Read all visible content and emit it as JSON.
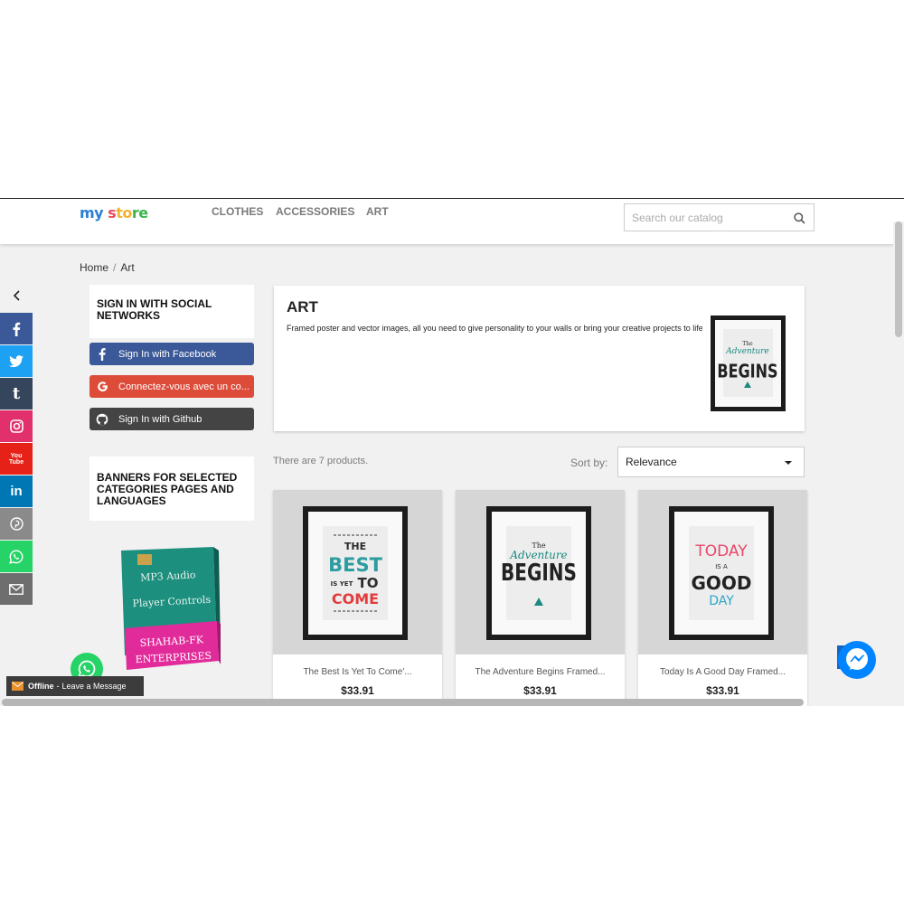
{
  "header": {
    "logo": {
      "part1": "my",
      "part2": " s",
      "part3": "to",
      "part4": "re"
    },
    "nav": [
      "CLOTHES",
      "ACCESSORIES",
      "ART"
    ],
    "search_placeholder": "Search our catalog"
  },
  "breadcrumb": {
    "home": "Home",
    "separator": "/",
    "current": "Art"
  },
  "social_bar": {
    "icons": [
      "facebook-icon",
      "twitter-icon",
      "tumblr-icon",
      "instagram-icon",
      "youtube-icon",
      "linkedin-icon",
      "pinterest-icon",
      "whatsapp-icon",
      "email-icon"
    ],
    "colors": [
      "#3b5998",
      "#1da1f2",
      "#35465c",
      "#e1306c",
      "#e62117",
      "#0077b5",
      "#8a8a8a",
      "#25d366",
      "#6e6e6e"
    ],
    "tumblr_glyph": "t",
    "youtube_glyph": "You\nTube",
    "linkedin_glyph": "in"
  },
  "social_login": {
    "title": "SIGN IN WITH SOCIAL NETWORKS",
    "facebook": "Sign In with Facebook",
    "google": "Connectez-vous avec un co...",
    "github": "Sign In with Github",
    "colors": {
      "facebook": "#3b5998",
      "google": "#dd4b39",
      "github": "#444444"
    }
  },
  "banners": {
    "title": "BANNERS FOR SELECTED CATEGORIES PAGES AND LANGUAGES"
  },
  "promo": {
    "line1": "MP3 Audio",
    "line2": "Player Controls",
    "line3": "SHAHAB-FK",
    "line4": "ENTERPRISES"
  },
  "chat": {
    "status": "Offline",
    "separator": "-",
    "message": "Leave a Message"
  },
  "category": {
    "title": "ART",
    "description": "Framed poster and vector images, all you need to give personality to your walls or bring your creative projects to life.",
    "poster": {
      "small": "The",
      "script": "Adventure",
      "big": "BEGINS"
    }
  },
  "listing": {
    "count_text": "There are 7 products.",
    "sort_label": "Sort by:",
    "sort_value": "Relevance"
  },
  "products": [
    {
      "name": "The Best Is Yet To Come'...",
      "price": "$33.91",
      "poster": {
        "l1": "THE",
        "l2": "BEST",
        "l3": "IS YET",
        "l4": "TO",
        "l5": "COME"
      }
    },
    {
      "name": "The Adventure Begins Framed...",
      "price": "$33.91",
      "poster": {
        "small": "The",
        "script": "Adventure",
        "big": "BEGINS"
      }
    },
    {
      "name": "Today Is A Good Day Framed...",
      "price": "$33.91",
      "poster": {
        "l1": "TODAY",
        "l2": "IS A",
        "l3": "GOOD",
        "l4": "DAY"
      }
    }
  ]
}
